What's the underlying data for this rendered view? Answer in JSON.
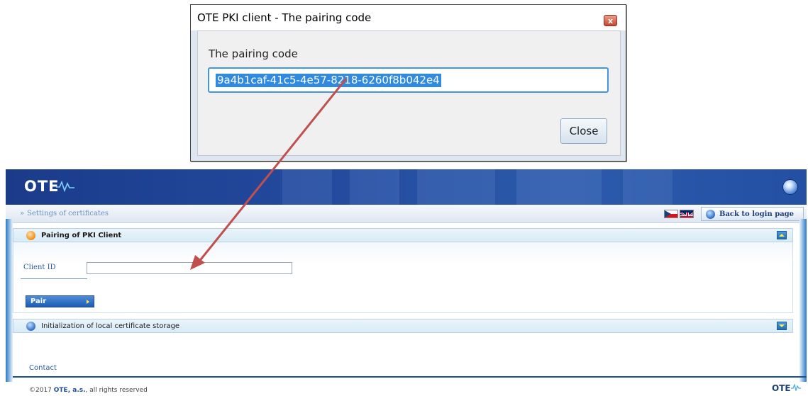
{
  "dialog": {
    "title": "OTE PKI client - The pairing code",
    "close_x": "x",
    "label": "The pairing code",
    "code_value": "9a4b1caf-41c5-4e57-8218-6260f8b042e4",
    "close_button": "Close"
  },
  "app": {
    "logo_text": "OTE",
    "breadcrumb_chevron": "»",
    "breadcrumb": "Settings of certificates",
    "back_button": "Back to login page",
    "panel_pairing": {
      "title": "Pairing of PKI Client"
    },
    "client_id_label": "Client ID",
    "client_id_value": "",
    "pair_button": "Pair",
    "panel_init": {
      "title": "Initialization of local certificate storage"
    },
    "contact_link": "Contact",
    "copyright_prefix": "©2017 ",
    "copyright_company": "OTE, a.s.",
    "copyright_suffix": ", all rights reserved",
    "footer_logo_text": "OTE"
  },
  "colors": {
    "header_blue": "#234a9e",
    "selection_blue": "#2f8ae0",
    "annotation_arrow": "#c0504d"
  }
}
